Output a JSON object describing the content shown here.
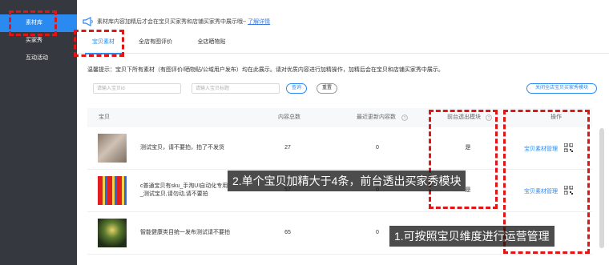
{
  "sidebar": {
    "items": [
      {
        "label": "素材库",
        "active": true
      },
      {
        "label": "买家秀"
      },
      {
        "label": "互动活动"
      }
    ]
  },
  "notice": {
    "icon": "megaphone-icon",
    "text": "素材库内容加精后才会在宝贝买家秀和店铺买家秀中展示哦~",
    "link": "了解详情"
  },
  "tabs": [
    "宝贝素材",
    "全店有图评价",
    "全店晒物贴"
  ],
  "tip": "温馨提示：宝贝下所有素材（有图评价/晒物贴/公域用户发布）均在此展示。请对优质内容进行加精操作，加精后会在宝贝和店铺买家秀中展示。",
  "search": {
    "input1_placeholder": "请输入宝贝id",
    "input2_placeholder": "请输入宝贝标题",
    "query": "查询",
    "reset": "重置",
    "close_module": "关闭全店宝贝买家秀模块"
  },
  "table": {
    "headers": [
      "宝贝",
      "内容总数",
      "最近更新内容数",
      "前台透出模块",
      "操作"
    ],
    "rows": [
      {
        "title": "测试宝贝，请不要拍，拍了不发货",
        "total": "27",
        "recent": "0",
        "front": "是",
        "op": "宝贝素材管理"
      },
      {
        "title": "c普通宝贝有sku_手淘UI自动化专用_测试宝贝,请勿动,请不要拍",
        "total": "57",
        "recent": "0",
        "front": "是",
        "op": "宝贝素材管理"
      },
      {
        "title": "智能健康类目统一发布测试请不要拍",
        "total": "65",
        "recent": "0",
        "front": "",
        "op": ""
      }
    ]
  },
  "overlays": {
    "middle": "2.单个宝贝加精大于4条，前台透出买家秀模块",
    "bottom": "1.可按照宝贝维度进行运营管理"
  },
  "colors": {
    "accent": "#2a8af0",
    "sidebar": "#35383e",
    "annotation": "#e01616"
  }
}
